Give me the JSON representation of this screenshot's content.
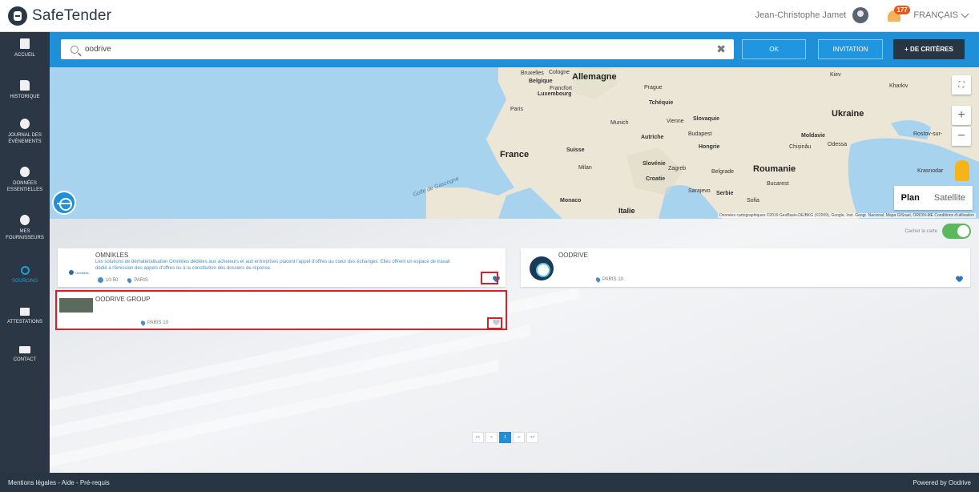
{
  "app": {
    "name": "SafeTender"
  },
  "header": {
    "user_name": "Jean-Christophe Jamet",
    "notifications_count": "177",
    "language": "FRANÇAIS"
  },
  "sidebar": {
    "items": [
      {
        "label": "ACCUEIL",
        "icon": "book-icon"
      },
      {
        "label": "HISTORIQUE",
        "icon": "document-icon"
      },
      {
        "label": "JOURNAL DES ÉVÉNEMENTS",
        "icon": "clock-icon"
      },
      {
        "label": "DONNÉES ESSENTIELLES",
        "icon": "database-icon"
      },
      {
        "label": "MES FOURNISSEURS",
        "icon": "globe-icon"
      },
      {
        "label": "SOURCING",
        "icon": "search-icon",
        "active": true
      },
      {
        "label": "ATTESTATIONS",
        "icon": "folder-icon"
      },
      {
        "label": "CONTACT",
        "icon": "mail-icon"
      }
    ]
  },
  "search": {
    "value": "oodrive",
    "placeholder": "",
    "ok_label": "OK",
    "invitation_label": "INVITATION",
    "criteria_label": "+ DE CRITÈRES"
  },
  "map": {
    "labels": {
      "allemagne": "Allemagne",
      "france": "France",
      "ukraine": "Ukraine",
      "roumanie": "Roumanie",
      "italie": "Italie",
      "bruxelles": "Bruxelles",
      "cologne": "Cologne",
      "belgique": "Belgique",
      "luxembourg": "Luxembourg",
      "frankfort": "Francfort",
      "prague": "Prague",
      "tchequie": "Tchéquie",
      "paris": "Paris",
      "munich": "Munich",
      "vienne": "Vienne",
      "slovaquie": "Slovaquie",
      "autriche": "Autriche",
      "budapest": "Budapest",
      "hongrie": "Hongrie",
      "moldavie": "Moldavie",
      "chisinau": "Chișinău",
      "odessa": "Odessa",
      "suisse": "Suisse",
      "milan": "Milan",
      "slovenie": "Slovénie",
      "zagreb": "Zagreb",
      "croatie": "Croatie",
      "belgrade": "Belgrade",
      "bucarest": "Bucarest",
      "sarajevo": "Sarajevo",
      "serbie": "Serbie",
      "sofia": "Sofia",
      "monaco": "Monaco",
      "kiev": "Kiev",
      "kharkiv": "Kharkiv",
      "rostov": "Rostov-sur-",
      "krasnodar": "Krasnodar",
      "golfe": "Golfe de Gascogne"
    },
    "plan_label": "Plan",
    "satellite_label": "Satellite",
    "copyright": "Données cartographiques ©2019 GeoBasis-DE/BKG (©2009), Google, Inst. Geogr. Nacional, Mapa GISrael, ORION-ME   Conditions d'utilisation",
    "colors": {
      "water": "#a8d3ef",
      "land": "#ece6d6"
    }
  },
  "results": {
    "hide_map_label": "Cacher la carte",
    "cards": [
      {
        "title": "OMNIKLES",
        "description": "Les solutions de dématérialisation Omnikles dédiées aux acheteurs et aux entreprises placent l'appel d'offres au cœur des échanges. Elles offrent un espace de travail dédié à l'émission des appels d'offres ou à la constitution des dossiers de réponse.",
        "employees": "10-50",
        "city": "PARIS",
        "logo_text": "Omnikles",
        "favorite": true
      },
      {
        "title": "OODRIVE",
        "city": "PARIS 10",
        "favorite": true
      },
      {
        "title": "OODRIVE GROUP",
        "city": "PARIS 10",
        "favorite": false
      }
    ],
    "pagination": [
      "<<",
      "<",
      "1",
      ">",
      ">>"
    ]
  },
  "footer": {
    "left": "Mentions légales - Aide - Pré-requis",
    "right": "Powered by Oodrive"
  },
  "colors": {
    "accent": "#1f8fd8",
    "sidebar": "#2b3744",
    "highlight": "#d8202a",
    "toggle_on": "#5cb85c"
  }
}
